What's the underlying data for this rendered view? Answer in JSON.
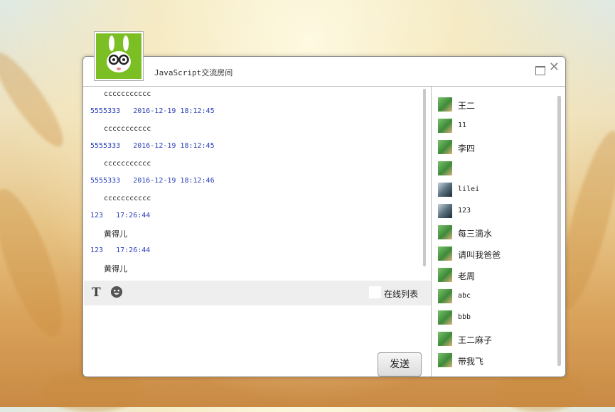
{
  "window": {
    "title": "JavaScript交流房间",
    "close_glyph": "✕"
  },
  "messages": [
    {
      "kind": "text",
      "text": "ccccccccccc",
      "mono": true
    },
    {
      "kind": "meta",
      "text": "5555333   2016-12-19 18:12:45"
    },
    {
      "kind": "text",
      "text": "ccccccccccc",
      "mono": true
    },
    {
      "kind": "meta",
      "text": "5555333   2016-12-19 18:12:45"
    },
    {
      "kind": "text",
      "text": "ccccccccccc",
      "mono": true
    },
    {
      "kind": "meta",
      "text": "5555333   2016-12-19 18:12:46"
    },
    {
      "kind": "text",
      "text": "ccccccccccc",
      "mono": true
    },
    {
      "kind": "meta",
      "text": "123   17:26:44"
    },
    {
      "kind": "text",
      "text": "黄得儿",
      "mono": false
    },
    {
      "kind": "meta",
      "text": "123   17:26:44"
    },
    {
      "kind": "text",
      "text": "黄得儿",
      "mono": false
    }
  ],
  "toolbar": {
    "font_icon": "text-format-icon",
    "font_glyph": "T",
    "emoji_icon": "emoji-icon",
    "online_list_label": "在线列表"
  },
  "send_label": "发送",
  "users": [
    {
      "name": "王二",
      "avatar": "green"
    },
    {
      "name": "11",
      "avatar": "green"
    },
    {
      "name": "李四",
      "avatar": "green"
    },
    {
      "name": "",
      "avatar": "green"
    },
    {
      "name": "lilei",
      "avatar": "dark"
    },
    {
      "name": "123",
      "avatar": "dark"
    },
    {
      "name": "每三滴水",
      "avatar": "green"
    },
    {
      "name": "请叫我爸爸",
      "avatar": "green"
    },
    {
      "name": "老周",
      "avatar": "green"
    },
    {
      "name": "abc",
      "avatar": "green"
    },
    {
      "name": "bbb",
      "avatar": "green"
    },
    {
      "name": "王二麻子",
      "avatar": "green"
    },
    {
      "name": "带我飞",
      "avatar": "green"
    }
  ],
  "colors": {
    "meta_text": "#2a3fb8",
    "avatar_bg": "#7bbf25"
  }
}
